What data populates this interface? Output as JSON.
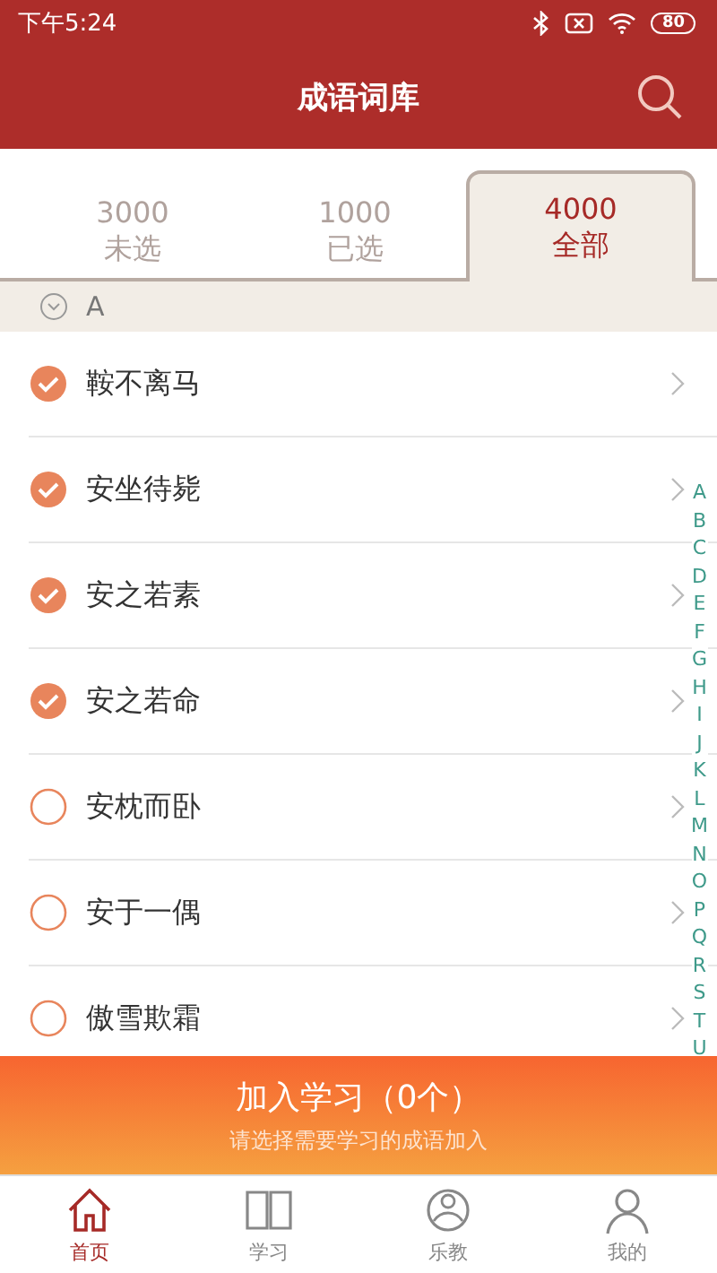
{
  "status_bar": {
    "time": "下午5:24",
    "battery": "80"
  },
  "header": {
    "title": "成语词库"
  },
  "tabs": [
    {
      "count": "3000",
      "label": "未选",
      "selected": false
    },
    {
      "count": "1000",
      "label": "已选",
      "selected": false
    },
    {
      "count": "4000",
      "label": "全部",
      "selected": true
    }
  ],
  "section": {
    "letter": "A",
    "expanded": true
  },
  "idioms": [
    {
      "text": "鞍不离马",
      "checked": true
    },
    {
      "text": "安坐待毙",
      "checked": true
    },
    {
      "text": "安之若素",
      "checked": true
    },
    {
      "text": "安之若命",
      "checked": true
    },
    {
      "text": "安枕而卧",
      "checked": false
    },
    {
      "text": "安于一偶",
      "checked": false
    },
    {
      "text": "傲雪欺霜",
      "checked": false
    }
  ],
  "index": [
    "A",
    "B",
    "C",
    "D",
    "E",
    "F",
    "G",
    "H",
    "I",
    "J",
    "K",
    "L",
    "M",
    "N",
    "O",
    "P",
    "Q",
    "R",
    "S",
    "T",
    "U"
  ],
  "add_button": {
    "label": "加入学习（0个）",
    "hint": "请选择需要学习的成语加入"
  },
  "nav": [
    {
      "label": "首页",
      "selected": true
    },
    {
      "label": "学习",
      "selected": false
    },
    {
      "label": "乐教",
      "selected": false
    },
    {
      "label": "我的",
      "selected": false
    }
  ]
}
